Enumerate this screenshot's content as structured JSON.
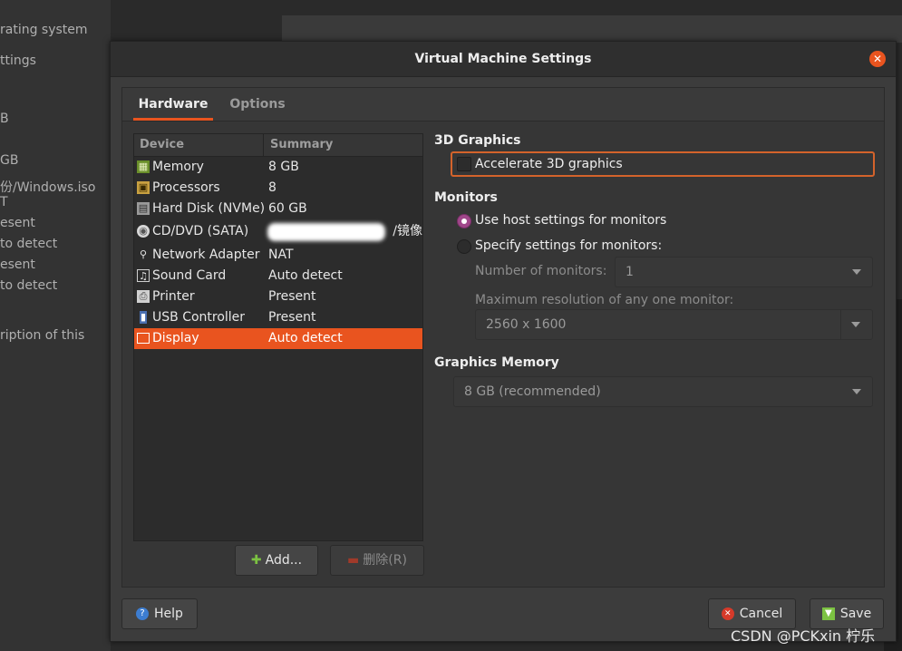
{
  "background": {
    "left_lines": [
      "rating system",
      "ttings",
      "B",
      "GB",
      "份/Windows.iso",
      "T",
      "esent",
      "to detect",
      "esent",
      "to detect",
      "ription of this"
    ]
  },
  "dialog": {
    "title": "Virtual Machine Settings",
    "tabs": [
      {
        "label": "Hardware",
        "active": true
      },
      {
        "label": "Options",
        "active": false
      }
    ],
    "device_table": {
      "columns": [
        "Device",
        "Summary"
      ],
      "rows": [
        {
          "icon": "memory-icon",
          "device": "Memory",
          "summary": "8 GB"
        },
        {
          "icon": "processor-icon",
          "device": "Processors",
          "summary": "8"
        },
        {
          "icon": "hard-disk-icon",
          "device": "Hard Disk (NVMe)",
          "summary": "60 GB"
        },
        {
          "icon": "cd-dvd-icon",
          "device": "CD/DVD (SATA)",
          "summary": "/镜像"
        },
        {
          "icon": "network-icon",
          "device": "Network Adapter",
          "summary": "NAT"
        },
        {
          "icon": "sound-card-icon",
          "device": "Sound Card",
          "summary": "Auto detect"
        },
        {
          "icon": "printer-icon",
          "device": "Printer",
          "summary": "Present"
        },
        {
          "icon": "usb-icon",
          "device": "USB Controller",
          "summary": "Present"
        },
        {
          "icon": "display-icon",
          "device": "Display",
          "summary": "Auto detect",
          "selected": true
        }
      ]
    },
    "add_button": "Add...",
    "remove_button": "删除(R)",
    "display_settings": {
      "graphics_3d_heading": "3D Graphics",
      "accelerate_label": "Accelerate 3D graphics",
      "accelerate_checked": false,
      "monitors_heading": "Monitors",
      "use_host_label": "Use host settings for monitors",
      "specify_label": "Specify settings for monitors:",
      "selected_option": "use_host",
      "num_monitors_label": "Number of monitors:",
      "num_monitors_value": "1",
      "max_res_label": "Maximum resolution of any one monitor:",
      "max_res_value": "2560 x 1600",
      "graphics_memory_heading": "Graphics Memory",
      "graphics_memory_value": "8 GB (recommended)"
    },
    "help_button": "Help",
    "cancel_button": "Cancel",
    "save_button": "Save"
  },
  "watermark": "CSDN @PCKxin 柠乐",
  "colors": {
    "accent": "#e9541f",
    "radio_on": "#a0478a"
  }
}
